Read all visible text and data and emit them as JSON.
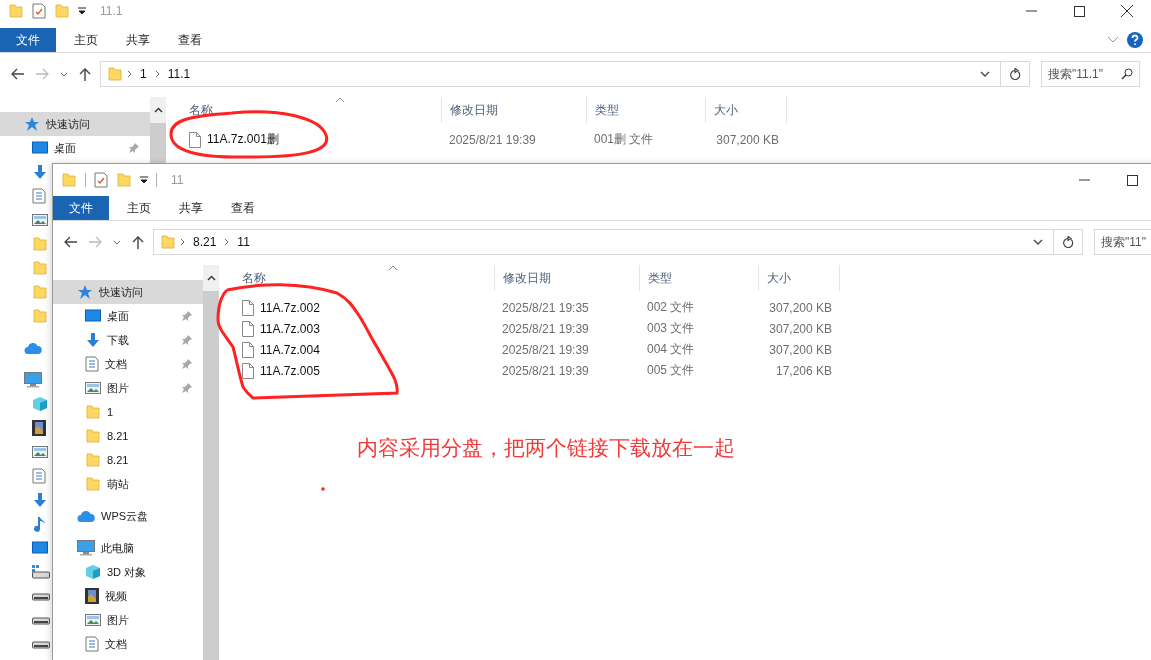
{
  "windows": [
    {
      "title": "11.1",
      "ribbon": [
        {
          "label": "文件",
          "kind": "file-menu"
        },
        {
          "label": "主页",
          "kind": "tab"
        },
        {
          "label": "共享",
          "kind": "tab"
        },
        {
          "label": "查看",
          "kind": "tab"
        }
      ],
      "path": [
        "1",
        "11.1"
      ],
      "search": {
        "placeholder": "搜索\"11.1\""
      },
      "columns": [
        "名称",
        "修改日期",
        "类型",
        "大小"
      ],
      "sidebar": {
        "items": [
          {
            "label": "快速访问",
            "kind": "quick-access",
            "selected": true,
            "children": [
              {
                "label": "桌面",
                "kind": "desktop",
                "pinned": true,
                "selected": false
              }
            ]
          }
        ]
      },
      "files": [
        {
          "name": "11A.7z.001删",
          "modified": "2025/8/21 19:39",
          "type": "001删 文件",
          "size": "307,200 KB"
        }
      ]
    },
    {
      "title": "11",
      "ribbon": [
        {
          "label": "文件",
          "kind": "file-menu"
        },
        {
          "label": "主页",
          "kind": "tab"
        },
        {
          "label": "共享",
          "kind": "tab"
        },
        {
          "label": "查看",
          "kind": "tab"
        }
      ],
      "path": [
        "8.21",
        "11"
      ],
      "search": {
        "placeholder": "搜索\"11\""
      },
      "columns": [
        "名称",
        "修改日期",
        "类型",
        "大小"
      ],
      "sidebar": {
        "items": [
          {
            "label": "快速访问",
            "kind": "quick-access",
            "selected": true,
            "children": [
              {
                "label": "桌面",
                "kind": "desktop",
                "pinned": true,
                "selected": false
              },
              {
                "label": "下载",
                "kind": "downloads",
                "pinned": true,
                "selected": false
              },
              {
                "label": "文档",
                "kind": "documents",
                "pinned": true,
                "selected": false
              },
              {
                "label": "图片",
                "kind": "pictures",
                "pinned": true,
                "selected": false
              },
              {
                "label": "1",
                "kind": "folder",
                "pinned": false,
                "selected": false
              },
              {
                "label": "8.21",
                "kind": "folder",
                "pinned": false,
                "selected": false
              },
              {
                "label": "8.21",
                "kind": "folder",
                "pinned": false,
                "selected": false
              },
              {
                "label": "萌站",
                "kind": "folder",
                "pinned": false,
                "selected": false
              }
            ]
          },
          {
            "label": "WPS云盘",
            "kind": "cloud",
            "selected": false
          },
          {
            "label": "此电脑",
            "kind": "pc",
            "selected": false,
            "children": [
              {
                "label": "3D 对象",
                "kind": "objects-3d",
                "selected": false
              },
              {
                "label": "视频",
                "kind": "videos",
                "selected": false
              },
              {
                "label": "图片",
                "kind": "pictures",
                "selected": false
              },
              {
                "label": "文档",
                "kind": "documents",
                "selected": false
              }
            ]
          }
        ]
      },
      "files": [
        {
          "name": "11A.7z.002",
          "modified": "2025/8/21 19:35",
          "type": "002 文件",
          "size": "307,200 KB"
        },
        {
          "name": "11A.7z.003",
          "modified": "2025/8/21 19:39",
          "type": "003 文件",
          "size": "307,200 KB"
        },
        {
          "name": "11A.7z.004",
          "modified": "2025/8/21 19:39",
          "type": "004 文件",
          "size": "307,200 KB"
        },
        {
          "name": "11A.7z.005",
          "modified": "2025/8/21 19:39",
          "type": "005 文件",
          "size": "17,206 KB"
        }
      ]
    }
  ],
  "annotation": {
    "note": "内容采用分盘，把两个链接下载放在一起"
  }
}
